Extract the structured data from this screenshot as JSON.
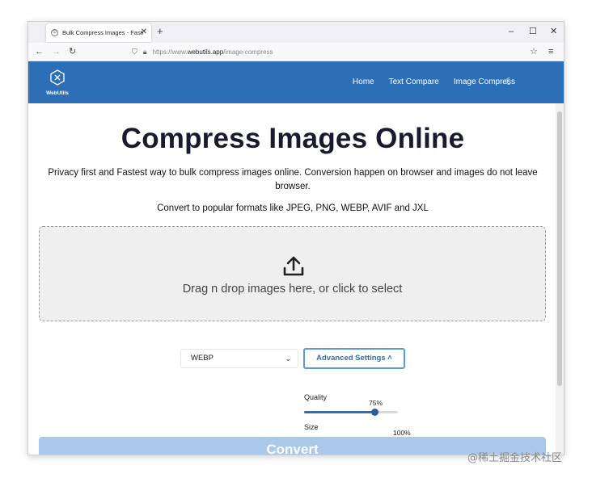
{
  "browser": {
    "tab_title": "Bulk Compress Images - Fastest",
    "new_tab": "+",
    "window_controls": {
      "minimize": "–",
      "maximize": "☐",
      "close": "✕"
    },
    "url_prefix": "https://www.",
    "url_domain": "webutils.app",
    "url_path": "/image-compress"
  },
  "header": {
    "logo_text": "WebUtils",
    "nav": [
      "Home",
      "Text Compare",
      "Image Compress"
    ],
    "theme_icon": "moon-icon"
  },
  "main": {
    "title": "Compress Images Online",
    "subtitle": "Privacy first and Fastest way to bulk compress images online. Conversion happen on browser and images do not leave browser.",
    "formats": "Convert to popular formats like JPEG, PNG, WEBP, AVIF and JXL",
    "dropzone_text": "Drag n drop images here, or click to select",
    "format_select": "WEBP",
    "advanced_label": "Advanced Settings",
    "quality": {
      "label": "Quality",
      "value_text": "75%",
      "value": 0.75
    },
    "size": {
      "label": "Size",
      "value_text": "100%",
      "value": 1.0
    },
    "convert_label": "Convert"
  },
  "watermark": "@稀土掘金技术社区",
  "colors": {
    "brand": "#2c6fb7",
    "convert_disabled": "#a9c8ea"
  }
}
